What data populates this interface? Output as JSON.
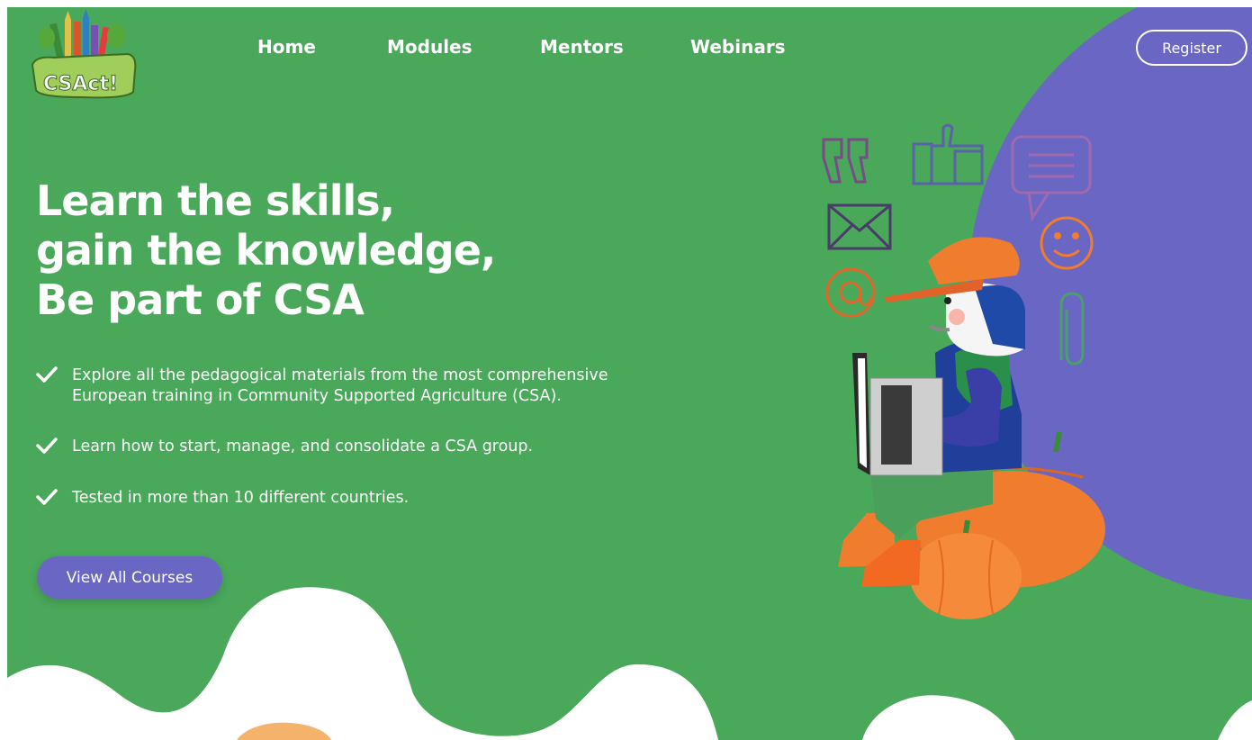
{
  "brand": {
    "logo_text": "CSAct!"
  },
  "nav": {
    "items": [
      {
        "label": "Home"
      },
      {
        "label": "Modules"
      },
      {
        "label": "Mentors"
      },
      {
        "label": "Webinars"
      }
    ],
    "register_label": "Register"
  },
  "hero": {
    "headline_lines": [
      "Learn the skills,",
      "gain the knowledge,",
      "Be part of CSA"
    ],
    "features": [
      {
        "icon": "check-icon",
        "text": "Explore all the pedagogical materials from the most comprehensive European training in Community Supported Agriculture (CSA)."
      },
      {
        "icon": "check-icon",
        "text": "Learn how to start, manage, and consolidate a CSA group."
      },
      {
        "icon": "check-icon",
        "text": "Tested in more than 10 different countries."
      }
    ],
    "cta_label": "View All Courses"
  },
  "illustration": {
    "icons": [
      "quote-icon",
      "thumbs-up-icon",
      "chat-bubble-icon",
      "envelope-icon",
      "smiley-icon",
      "at-sign-icon",
      "paperclip-icon"
    ],
    "subject": "farmer-with-laptop-on-pumpkins"
  },
  "colors": {
    "hero_green": "#49a85a",
    "purple": "#6a66c3",
    "orange": "#f07c2e",
    "white": "#ffffff"
  }
}
